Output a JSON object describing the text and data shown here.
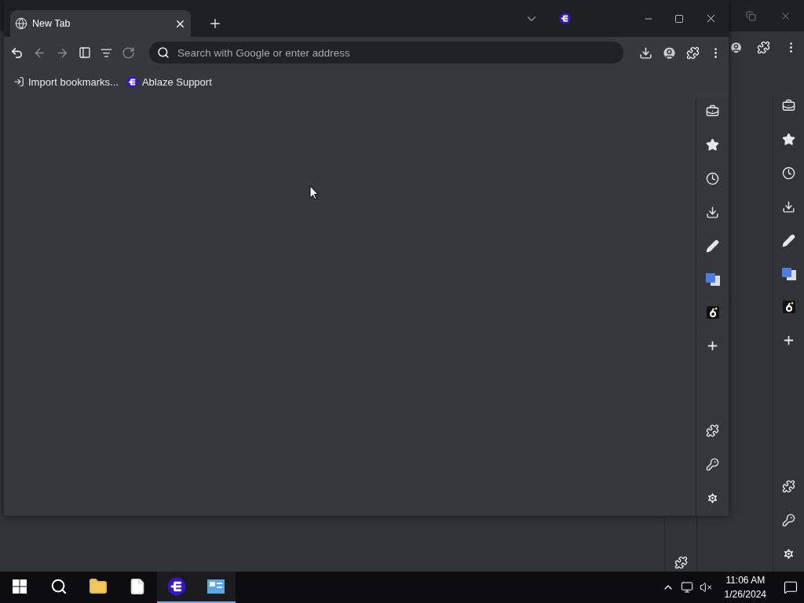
{
  "window": {
    "tabs": [
      {
        "title": "New Tab",
        "selected": true
      }
    ],
    "address_bar": {
      "placeholder": "Search with Google or enter address"
    },
    "bookmarks": [
      {
        "label": "Import bookmarks...",
        "kind": "import"
      },
      {
        "label": "Ablaze Support",
        "kind": "site"
      }
    ]
  },
  "taskbar": {
    "apps": [
      {
        "kind": "folder",
        "running": false
      },
      {
        "kind": "file",
        "running": false
      },
      {
        "kind": "browser",
        "running": true
      },
      {
        "kind": "panel",
        "running": true
      }
    ],
    "time": "11:06 AM",
    "date": "1/26/2024"
  }
}
